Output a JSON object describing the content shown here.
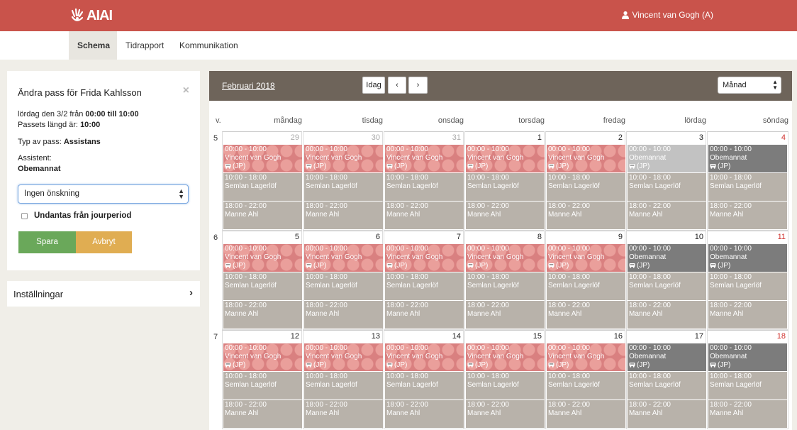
{
  "header": {
    "logo_text": "AIAI",
    "user_name": "Vincent van Gogh (A)",
    "brand_color": "#c9534b"
  },
  "nav": {
    "tabs": [
      {
        "label": "Schema",
        "active": true
      },
      {
        "label": "Tidrapport",
        "active": false
      },
      {
        "label": "Kommunikation",
        "active": false
      }
    ]
  },
  "edit_panel": {
    "title": "Ändra pass för Frida Kahlsson",
    "date_prefix": "lördag den 3/2 från ",
    "time_from": "00:00",
    "time_sep": " till ",
    "time_to": "10:00",
    "length_prefix": "Passets längd är: ",
    "length_value": "10:00",
    "type_prefix": "Typ av pass: ",
    "type_value": "Assistans",
    "assistant_label": "Assistent:",
    "assistant_value": "Obemannat",
    "wish_select": "Ingen önskning",
    "exclude_label": "Undantas från jourperiod",
    "save_label": "Spara",
    "cancel_label": "Avbryt"
  },
  "settings": {
    "label": "Inställningar"
  },
  "calendar": {
    "month_label": "Februari 2018",
    "today_label": "Idag",
    "view_select": "Månad",
    "week_label": "v.",
    "weekdays": [
      "måndag",
      "tisdag",
      "onsdag",
      "torsdag",
      "fredag",
      "lördag",
      "söndag"
    ],
    "weeks": [
      {
        "number": "5",
        "days": [
          {
            "num": "29",
            "style": "muted",
            "first": {
              "time": "00:00 - 10:00",
              "name": "Vincent van Gogh",
              "tag": "(JP)",
              "kind": "pattern"
            }
          },
          {
            "num": "30",
            "style": "muted",
            "first": {
              "time": "00:00 - 10:00",
              "name": "Vincent van Gogh",
              "tag": "(JP)",
              "kind": "pattern"
            }
          },
          {
            "num": "31",
            "style": "muted",
            "first": {
              "time": "00:00 - 10:00",
              "name": "Vincent van Gogh",
              "tag": "(JP)",
              "kind": "pattern"
            }
          },
          {
            "num": "1",
            "style": "",
            "first": {
              "time": "00:00 - 10:00",
              "name": "Vincent van Gogh",
              "tag": "(JP)",
              "kind": "pattern"
            }
          },
          {
            "num": "2",
            "style": "",
            "first": {
              "time": "00:00 - 10:00",
              "name": "Vincent van Gogh",
              "tag": "(JP)",
              "kind": "pattern"
            }
          },
          {
            "num": "3",
            "style": "",
            "first": {
              "time": "00:00 - 10:00",
              "name": "Obemannat",
              "tag": "(JP)",
              "kind": "light"
            }
          },
          {
            "num": "4",
            "style": "red",
            "first": {
              "time": "00:00 - 10:00",
              "name": "Obemannat",
              "tag": "(JP)",
              "kind": "dark"
            }
          }
        ]
      },
      {
        "number": "6",
        "days": [
          {
            "num": "5",
            "style": "",
            "first": {
              "time": "00:00 - 10:00",
              "name": "Vincent van Gogh",
              "tag": "(JP)",
              "kind": "pattern"
            }
          },
          {
            "num": "6",
            "style": "",
            "first": {
              "time": "00:00 - 10:00",
              "name": "Vincent van Gogh",
              "tag": "(JP)",
              "kind": "pattern"
            }
          },
          {
            "num": "7",
            "style": "",
            "first": {
              "time": "00:00 - 10:00",
              "name": "Vincent van Gogh",
              "tag": "(JP)",
              "kind": "pattern"
            }
          },
          {
            "num": "8",
            "style": "",
            "first": {
              "time": "00:00 - 10:00",
              "name": "Vincent van Gogh",
              "tag": "(JP)",
              "kind": "pattern"
            }
          },
          {
            "num": "9",
            "style": "",
            "first": {
              "time": "00:00 - 10:00",
              "name": "Vincent van Gogh",
              "tag": "(JP)",
              "kind": "pattern"
            }
          },
          {
            "num": "10",
            "style": "",
            "first": {
              "time": "00:00 - 10:00",
              "name": "Obemannat",
              "tag": "(JP)",
              "kind": "dark"
            }
          },
          {
            "num": "11",
            "style": "red",
            "first": {
              "time": "00:00 - 10:00",
              "name": "Obemannat",
              "tag": "(JP)",
              "kind": "dark"
            }
          }
        ]
      },
      {
        "number": "7",
        "days": [
          {
            "num": "12",
            "style": "",
            "first": {
              "time": "00:00 - 10:00",
              "name": "Vincent van Gogh",
              "tag": "(JP)",
              "kind": "pattern"
            }
          },
          {
            "num": "13",
            "style": "",
            "first": {
              "time": "00:00 - 10:00",
              "name": "Vincent van Gogh",
              "tag": "(JP)",
              "kind": "pattern"
            }
          },
          {
            "num": "14",
            "style": "",
            "first": {
              "time": "00:00 - 10:00",
              "name": "Vincent van Gogh",
              "tag": "(JP)",
              "kind": "pattern"
            }
          },
          {
            "num": "15",
            "style": "",
            "first": {
              "time": "00:00 - 10:00",
              "name": "Vincent van Gogh",
              "tag": "(JP)",
              "kind": "pattern"
            }
          },
          {
            "num": "16",
            "style": "",
            "first": {
              "time": "00:00 - 10:00",
              "name": "Vincent van Gogh",
              "tag": "(JP)",
              "kind": "pattern"
            }
          },
          {
            "num": "17",
            "style": "",
            "first": {
              "time": "00:00 - 10:00",
              "name": "Obemannat",
              "tag": "(JP)",
              "kind": "dark"
            }
          },
          {
            "num": "18",
            "style": "red",
            "first": {
              "time": "00:00 - 10:00",
              "name": "Obemannat",
              "tag": "(JP)",
              "kind": "dark"
            }
          }
        ]
      }
    ],
    "shift_mid": {
      "time": "10:00 - 18:00",
      "name": "Semlan Lagerlöf"
    },
    "shift_late": {
      "time": "18:00 - 22:00",
      "name": "Manne Ahl"
    }
  }
}
